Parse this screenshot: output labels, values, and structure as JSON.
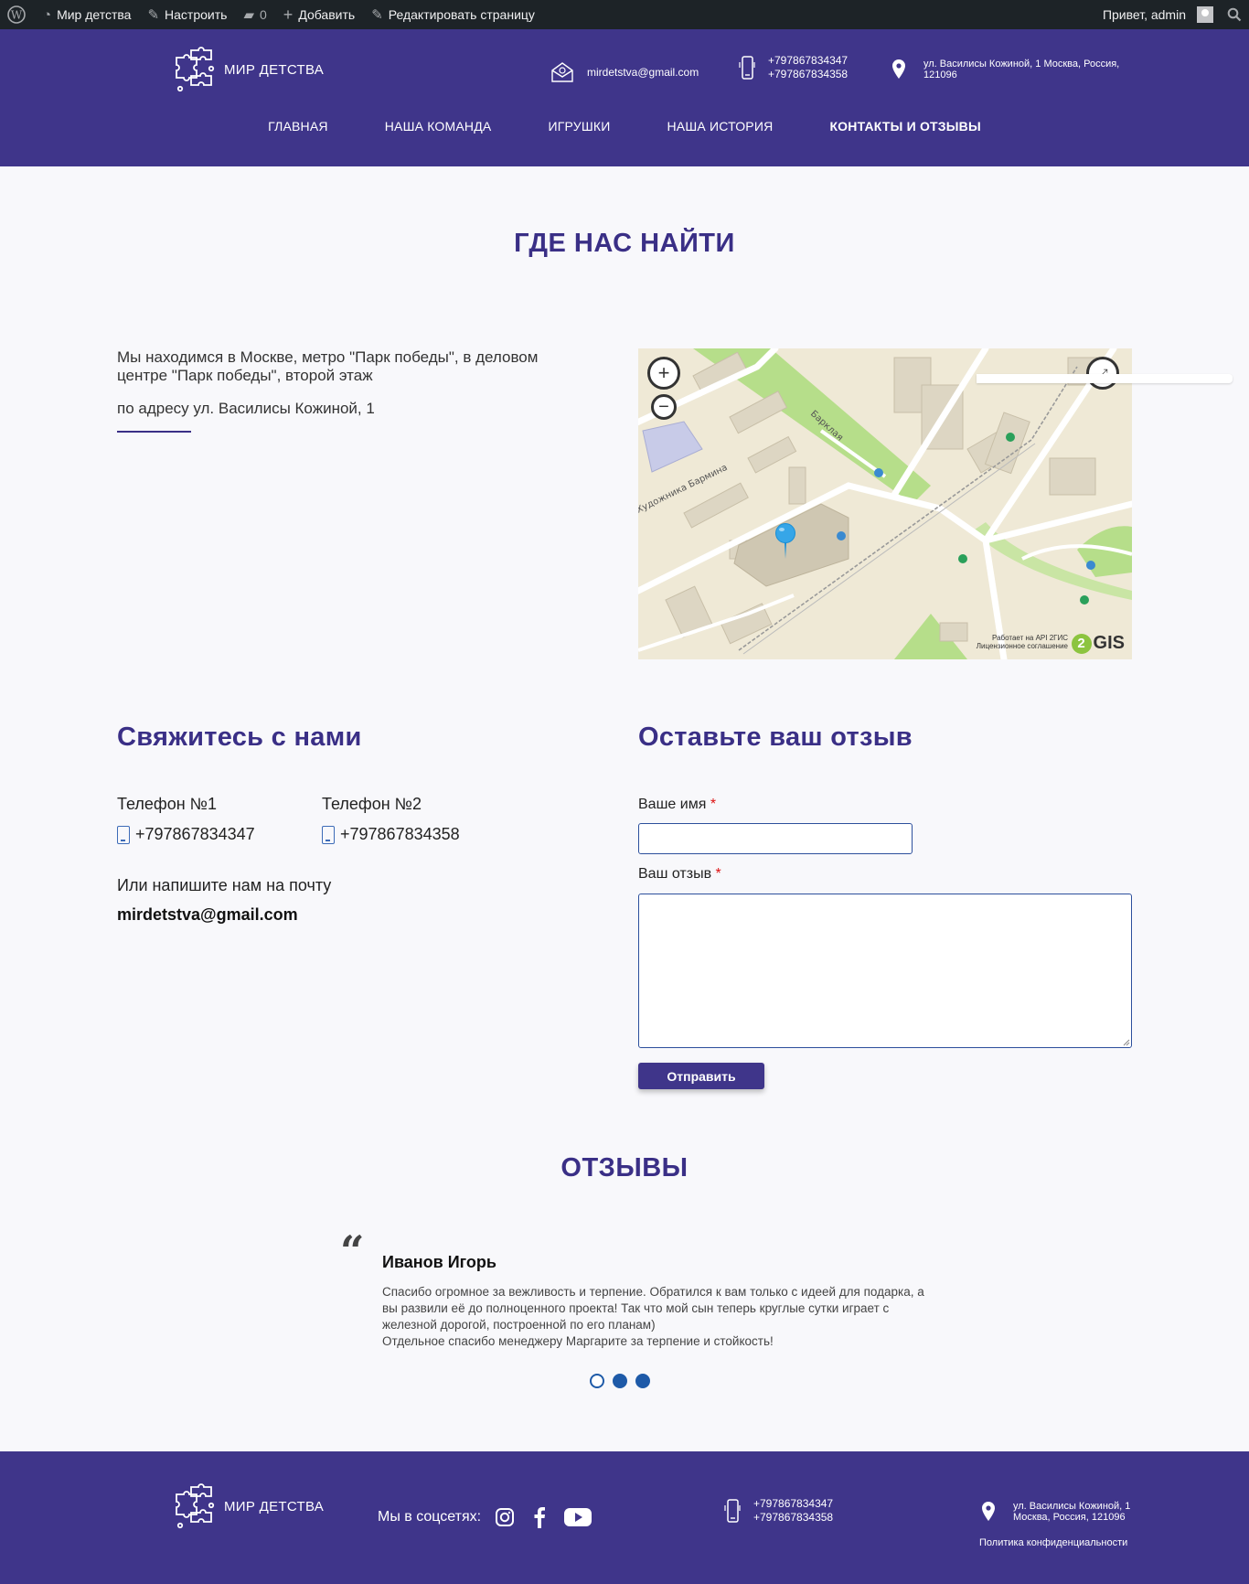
{
  "adminbar": {
    "site_name": "Мир детства",
    "customize": "Настроить",
    "comments_count": "0",
    "add": "Добавить",
    "edit_page": "Редактировать страницу",
    "greeting": "Привет, admin"
  },
  "header": {
    "logo_text": "МИР ДЕТСТВА",
    "email": "mirdetstva@gmail.com",
    "phone1": "+797867834347",
    "phone2": "+797867834358",
    "address": "ул. Василисы Кожиной, 1 Москва, Россия, 121096"
  },
  "nav": [
    "ГЛАВНАЯ",
    "НАША КОМАНДА",
    "ИГРУШКИ",
    "НАША ИСТОРИЯ",
    "КОНТАКТЫ И ОТЗЫВЫ"
  ],
  "where": {
    "title": "ГДЕ НАС НАЙТИ",
    "text1": "Мы находимся в Москве, метро \"Парк победы\", в деловом центре \"Парк победы\", второй этаж",
    "text2": "по адресу ул. Василисы Кожиной, 1"
  },
  "map": {
    "street1": "Барклая",
    "street2": "Художника Барминa",
    "attr1": "Работает на API 2ГИС",
    "attr2": "Лицензионное соглашение",
    "brand": "GIS",
    "brand_num": "2"
  },
  "contact": {
    "title": "Свяжитесь с нами",
    "phone1_label": "Телефон №1",
    "phone2_label": "Телефон №2",
    "phone1": "+797867834347",
    "phone2": "+797867834358",
    "mail_label": "Или напишите нам на почту",
    "email": "mirdetstva@gmail.com"
  },
  "feedback": {
    "title": "Оставьте ваш отзыв",
    "name_label": "Ваше имя",
    "review_label": "Ваш отзыв",
    "required": "*",
    "submit": "Отправить"
  },
  "reviews": {
    "title": "ОТЗЫВЫ",
    "name": "Иванов Игорь",
    "text_line1": "Спасибо огромное за вежливость и терпение. Обратился к вам только с идеей для подарка, а вы развили её до полноценного проекта! Так что мой сын теперь круглые сутки играет с железной дорогой, построенной по его планам)",
    "text_line2": "Отдельное спасибо менеджеру Маргарите за терпение и стойкость!"
  },
  "footer": {
    "logo_text": "МИР ДЕТСТВА",
    "social_label": "Мы в соцсетях:",
    "phone1": "+797867834347",
    "phone2": "+797867834358",
    "address_line1": "ул. Василисы Кожиной, 1",
    "address_line2": "Москва, Россия, 121096",
    "privacy": "Политика конфиденциальности"
  },
  "colors": {
    "brand": "#3f358a",
    "heading": "#3a2f86",
    "adminbar": "#1d2327",
    "accent_blue": "#1e5aa8"
  }
}
